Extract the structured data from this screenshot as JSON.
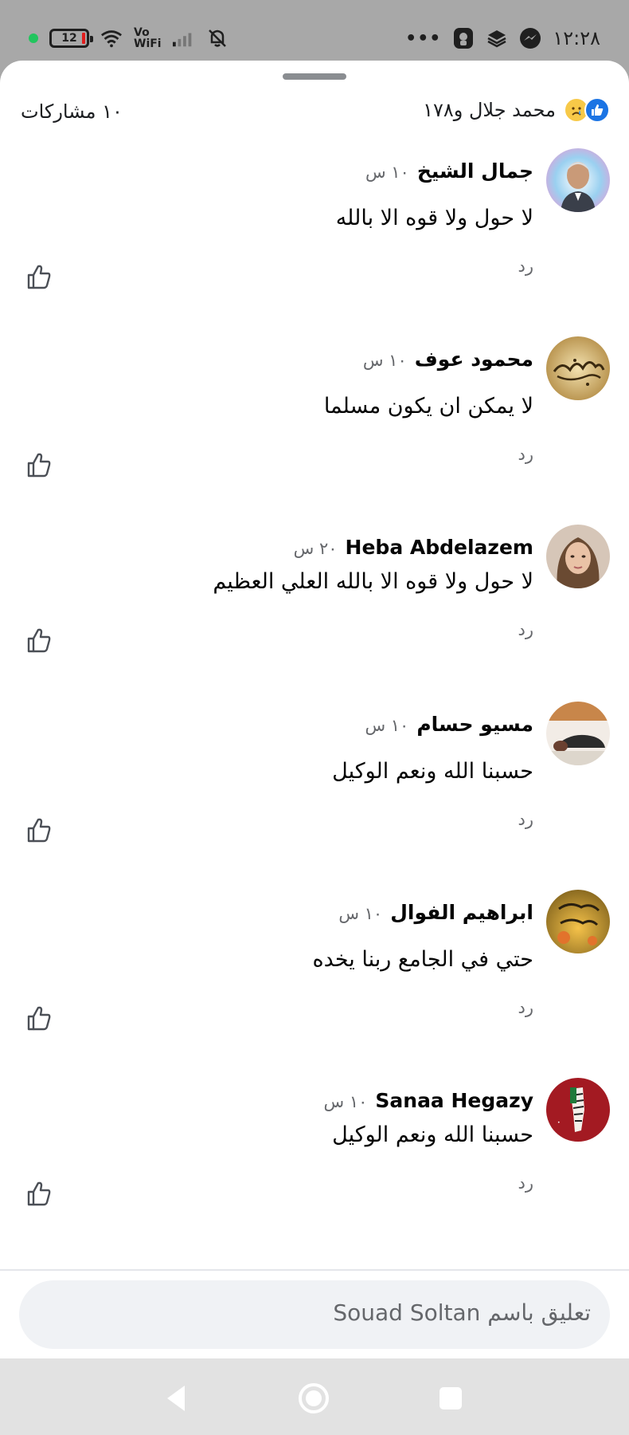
{
  "status_bar": {
    "time": "١٢:٢٨",
    "battery": "12",
    "network_label_top": "Vo",
    "network_label_bottom": "WiFi",
    "overflow": "•••"
  },
  "post_header": {
    "shares": "١٠ مشاركات",
    "reactions_text": "محمد جلال و١٧٨"
  },
  "comments": [
    {
      "name": "جمال الشيخ",
      "time": "١٠ س",
      "text": "لا حول ولا قوه الا بالله",
      "reply": "رد"
    },
    {
      "name": "محمود عوف",
      "time": "١٠ س",
      "text": "لا يمكن ان يكون مسلما",
      "reply": "رد"
    },
    {
      "name": "Heba Abdelazem",
      "time": "٢٠ س",
      "text": "لا حول ولا قوه الا بالله العلي العظيم",
      "reply": "رد"
    },
    {
      "name": "مسيو حسام",
      "time": "١٠ س",
      "text": "حسبنا الله ونعم الوكيل",
      "reply": "رد"
    },
    {
      "name": "ابراهيم الفوال",
      "time": "١٠ س",
      "text": "حتي في الجامع ربنا يخده",
      "reply": "رد"
    },
    {
      "name": "Sanaa Hegazy",
      "time": "١٠ س",
      "text": "حسبنا الله ونعم الوكيل",
      "reply": "رد"
    }
  ],
  "composer": {
    "placeholder": "تعليق باسم Souad Soltan"
  },
  "colors": {
    "facebook_blue": "#1b74e4",
    "secondary_text": "#65676b",
    "composer_bg": "#f0f2f5"
  }
}
